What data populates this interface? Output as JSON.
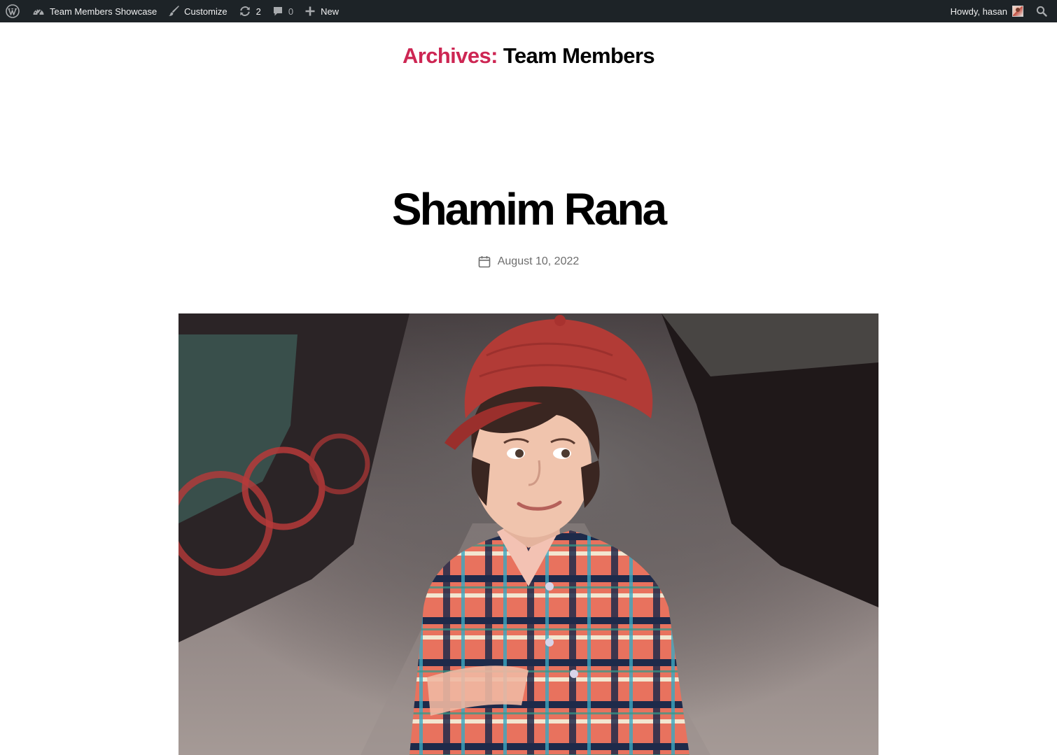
{
  "admin_bar": {
    "site_name": "Team Members Showcase",
    "customize_label": "Customize",
    "updates_count": "2",
    "comments_count": "0",
    "new_label": "New",
    "greeting": "Howdy, hasan",
    "icons": {
      "wordpress": "wordpress-logo-icon",
      "site": "dashboard-gauge-icon",
      "customize": "paintbrush-icon",
      "updates": "refresh-icon",
      "comments": "speech-bubble-icon",
      "new": "plus-icon",
      "search": "search-icon"
    }
  },
  "archive": {
    "prefix": "Archives:",
    "title": "Team Members",
    "prefix_color": "#cd2653"
  },
  "post": {
    "title": "Shamim Rana",
    "date": "August 10, 2022",
    "date_icon": "calendar-icon",
    "featured_image": "boy-in-red-cap-and-plaid-shirt-photo"
  },
  "colors": {
    "admin_bar_bg": "#1d2327",
    "accent": "#cd2653",
    "text": "#000000",
    "meta_text": "#6d6d6d"
  }
}
